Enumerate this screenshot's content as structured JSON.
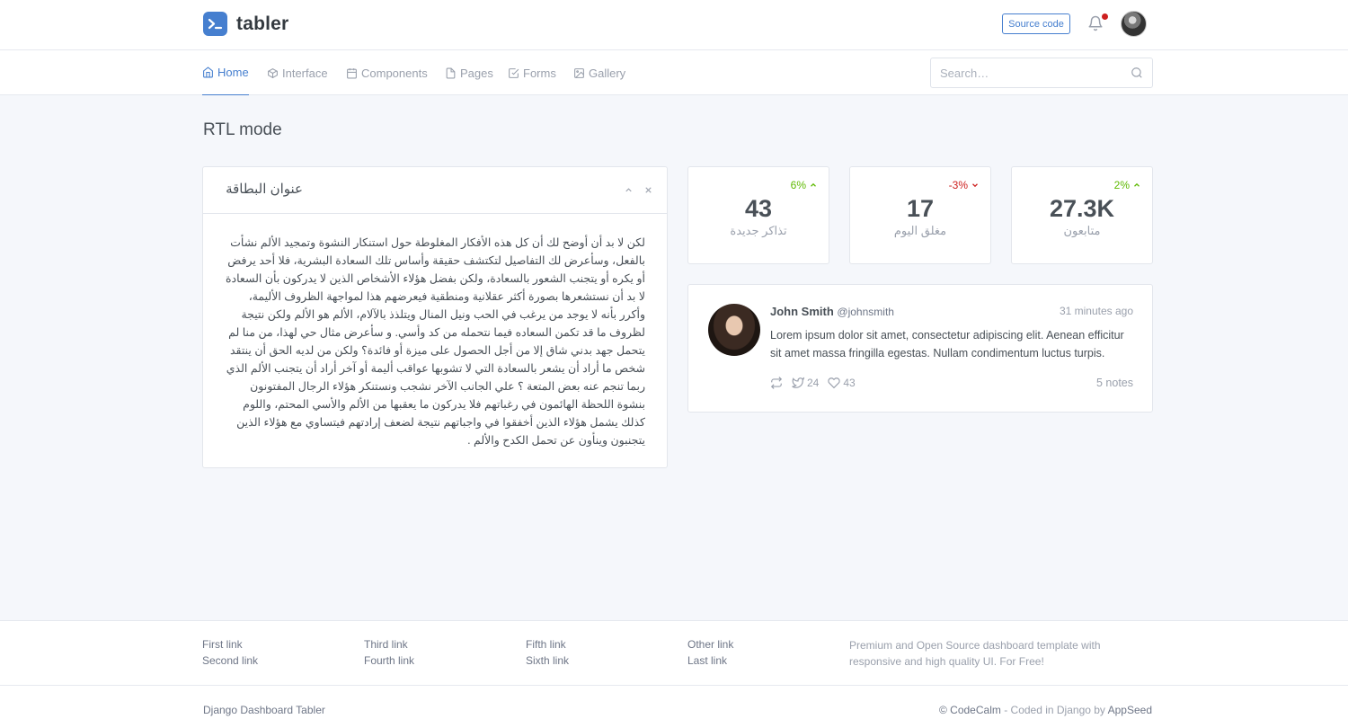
{
  "brand": {
    "name": "tabler",
    "accent": "#467fcf"
  },
  "header": {
    "source_code_label": "Source code",
    "notification_icon": "bell-icon",
    "danger": "#cd201f"
  },
  "nav": {
    "items": [
      {
        "label": "Home",
        "icon": "home-icon"
      },
      {
        "label": "Interface",
        "icon": "box-icon"
      },
      {
        "label": "Components",
        "icon": "calendar-icon"
      },
      {
        "label": "Pages",
        "icon": "file-icon"
      },
      {
        "label": "Forms",
        "icon": "check-square-icon"
      },
      {
        "label": "Gallery",
        "icon": "image-icon"
      }
    ],
    "search_placeholder": "Search…"
  },
  "page": {
    "title": "RTL mode"
  },
  "rtl_card": {
    "title": "عنوان البطاقة",
    "body": "لكن لا بد أن أوضح لك أن كل هذه الأفكار المغلوطة حول استنكار النشوة وتمجيد الألم نشأت بالفعل، وسأعرض لك التفاصيل لتكتشف حقيقة وأساس تلك السعادة البشرية، فلا أحد يرفض أو يكره أو يتجنب الشعور بالسعادة، ولكن بفضل هؤلاء الأشخاص الذين لا يدركون بأن السعادة لا بد أن نستشعرها بصورة أكثر عقلانية ومنطقية فيعرضهم هذا لمواجهة الظروف الأليمة، وأكرر بأنه لا يوجد من يرغب في الحب ونيل المنال ويتلذذ بالآلام، الألم هو الألم ولكن نتيجة لظروف ما قد تكمن السعاده فيما نتحمله من كد وأسي. و سأعرض مثال حي لهذا، من منا لم يتحمل جهد بدني شاق إلا من أجل الحصول على ميزة أو فائدة؟ ولكن من لديه الحق أن ينتقد شخص ما أراد أن يشعر بالسعادة التي لا تشوبها عواقب أليمة أو آخر أراد أن يتجنب الألم الذي ربما تنجم عنه بعض المتعة ؟ علي الجانب الآخر نشجب ونستنكر هؤلاء الرجال المفتونون بنشوة اللحظة الهائمون في رغباتهم فلا يدركون ما يعقبها من الألم والأسي المحتم، واللوم كذلك يشمل هؤلاء الذين أخفقوا في واجباتهم نتيجة لضعف إرادتهم فيتساوي مع هؤلاء الذين يتجنبون وينأون عن تحمل الكدح والألم ."
  },
  "stats": [
    {
      "value": "27.3K",
      "label": "متابعون",
      "change": "2%",
      "trend": "up"
    },
    {
      "value": "17",
      "label": "مغلق اليوم",
      "change": "-3%",
      "trend": "down"
    },
    {
      "value": "43",
      "label": "تذاكر جديدة",
      "change": "6%",
      "trend": "up"
    }
  ],
  "colors": {
    "up": "#5eba00",
    "down": "#cd201f"
  },
  "tweet": {
    "name": "John Smith",
    "handle": "@johnsmith",
    "time": "31 minutes ago",
    "text": "Lorem ipsum dolor sit amet, consectetur adipiscing elit. Aenean efficitur sit amet massa fringilla egestas. Nullam condimentum luctus turpis.",
    "retweets": "24",
    "likes": "43",
    "notes": "5 notes"
  },
  "footer": {
    "links": [
      "First link",
      "Second link",
      "Third link",
      "Fourth link",
      "Fifth link",
      "Sixth link",
      "Other link",
      "Last link"
    ],
    "description": "Premium and Open Source dashboard template with responsive and high quality UI. For Free!",
    "copyright_left": "Django Dashboard Tabler",
    "copyright_brand": "© CodeCalm",
    "copyright_mid": " - Coded in Django by ",
    "copyright_author": "AppSeed"
  }
}
